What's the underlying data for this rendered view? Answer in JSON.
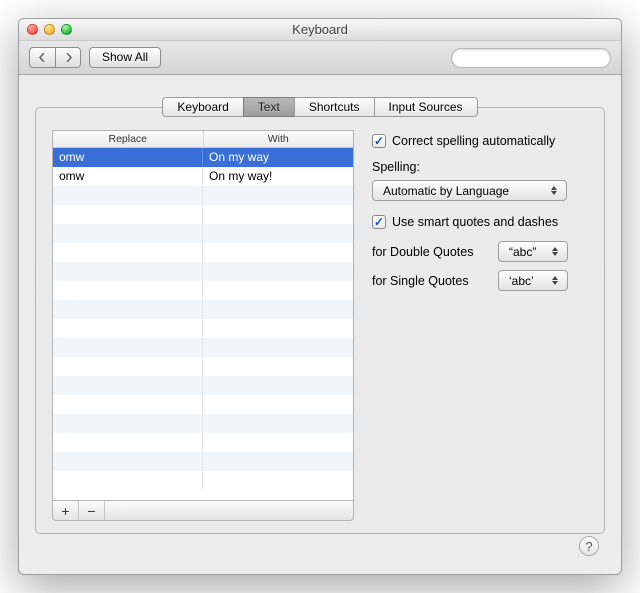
{
  "window": {
    "title": "Keyboard"
  },
  "toolbar": {
    "show_all": "Show All",
    "search_placeholder": ""
  },
  "tabs": [
    {
      "label": "Keyboard"
    },
    {
      "label": "Text"
    },
    {
      "label": "Shortcuts"
    },
    {
      "label": "Input Sources"
    }
  ],
  "active_tab_index": 1,
  "table": {
    "headers": {
      "replace": "Replace",
      "with": "With"
    },
    "rows": [
      {
        "replace": "omw",
        "with": "On my way",
        "selected": true
      },
      {
        "replace": "omw",
        "with": "On my way!",
        "selected": false
      }
    ],
    "total_visible_rows": 18
  },
  "buttons": {
    "add": "+",
    "remove": "−"
  },
  "options": {
    "correct_spelling": {
      "label": "Correct spelling automatically",
      "checked": true
    },
    "spelling_label": "Spelling:",
    "spelling_value": "Automatic by Language",
    "smart_quotes": {
      "label": "Use smart quotes and dashes",
      "checked": true
    },
    "double_quotes": {
      "label": "for Double Quotes",
      "value": "“abc”"
    },
    "single_quotes": {
      "label": "for Single Quotes",
      "value": "‘abc’"
    }
  },
  "help": "?"
}
